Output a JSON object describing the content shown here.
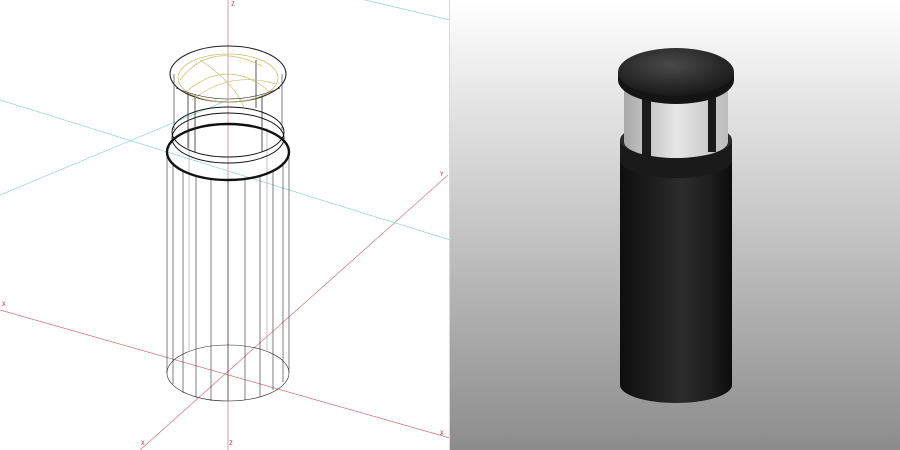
{
  "wireframe_view": {
    "axis_labels": {
      "z_top": "Z",
      "y_right": "Y",
      "x_left": "X",
      "x_bottom": "X",
      "z_bottom": "Z",
      "x_right": "X"
    },
    "colors": {
      "background": "#ffffff",
      "axis_red": "#d0707a",
      "axis_cyan": "#8fd6d2",
      "wire": "#2a2a2a",
      "lamp_wire": "#c8c070"
    }
  },
  "render_view": {
    "colors": {
      "gradient_top": "#ffffff",
      "gradient_bottom": "#8c8c8c",
      "body": "#1e1e1e",
      "cap": "#2a2a2a",
      "diffuser": "#d8d8d8"
    }
  }
}
